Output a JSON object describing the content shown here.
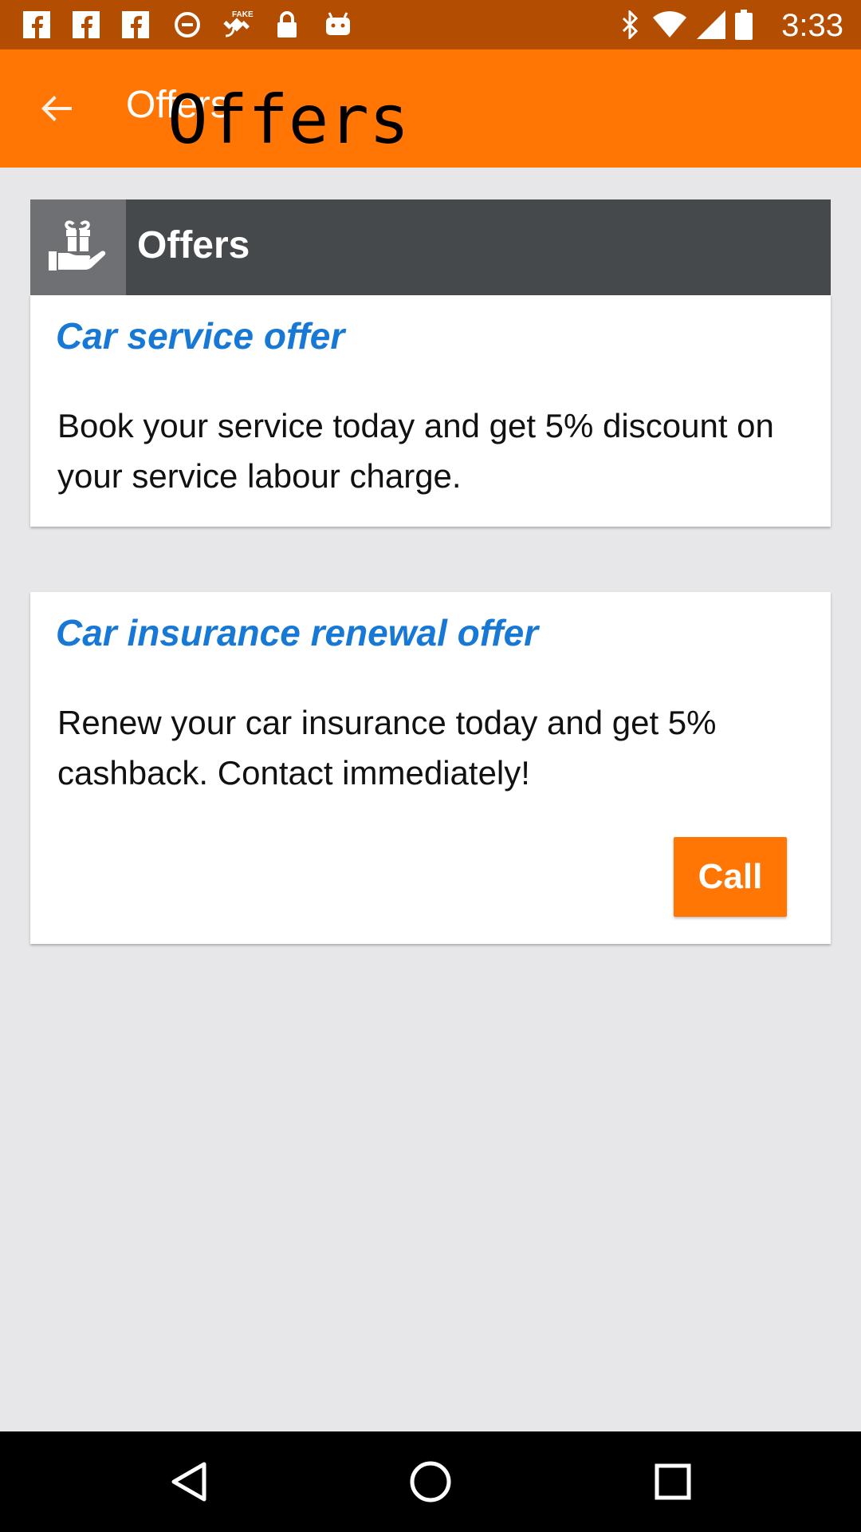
{
  "status_bar": {
    "time": "3:33",
    "icons": [
      "facebook-icon",
      "facebook-icon",
      "facebook-icon",
      "data-saver-icon",
      "fake-gps-icon",
      "lock-icon",
      "android-icon",
      "bluetooth-icon",
      "wifi-icon",
      "signal-icon",
      "battery-icon"
    ]
  },
  "app_bar": {
    "back_icon": "arrow-back-icon",
    "title": "Offers",
    "overlay_title": "Offers"
  },
  "header_card": {
    "icon": "gift-hand-icon",
    "label": "Offers"
  },
  "offers": [
    {
      "title": "Car service offer",
      "body": "Book your service today and get 5% discount on your service labour charge."
    },
    {
      "title": "Car insurance renewal offer",
      "body": "Renew your car insurance today and get 5% cashback. Contact immediately!",
      "button_label": "Call"
    }
  ],
  "nav_bar": {
    "icons": [
      "back-triangle-icon",
      "home-circle-icon",
      "recents-square-icon"
    ]
  },
  "colors": {
    "status_bar": "#b34d02",
    "app_bar": "#ff7605",
    "accent_blue": "#1779d5",
    "header_card": "#46494c",
    "background": "#e7e6e8"
  }
}
